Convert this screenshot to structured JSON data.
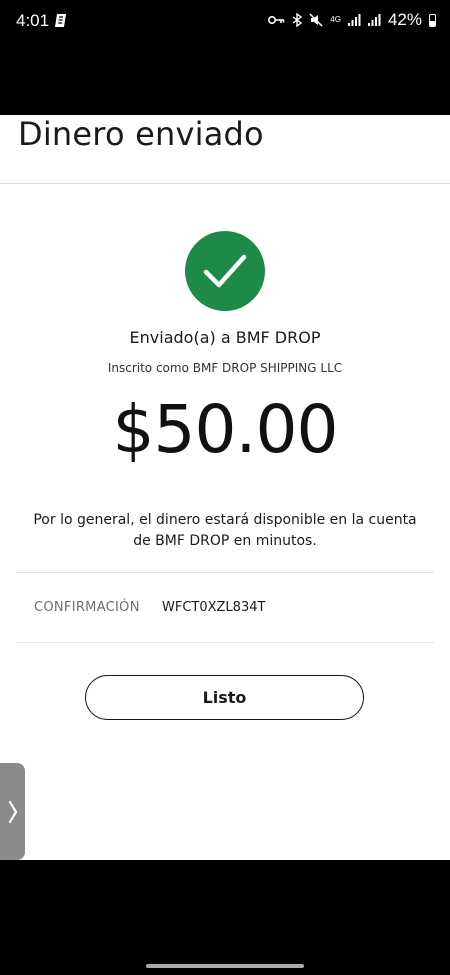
{
  "status_bar": {
    "time": "4:01",
    "network": "4G",
    "battery": "42%"
  },
  "page": {
    "title": "Dinero enviado"
  },
  "confirmation": {
    "sent_to": "Enviado(a) a BMF DROP",
    "registered_as": "Inscrito como BMF DROP SHIPPING LLC",
    "amount": "$50.00",
    "notice": "Por lo general, el dinero estará disponible en la cuenta de BMF DROP en minutos.",
    "conf_label": "CONFIRMACIÓN",
    "conf_value": "WFCT0XZL834T",
    "done_label": "Listo"
  },
  "colors": {
    "success": "#1e8a47",
    "background": "#ffffff",
    "system_bars": "#000000"
  },
  "icons": [
    "checkmark-icon",
    "vpn-key-icon",
    "bluetooth-icon",
    "mute-icon",
    "signal-icon",
    "battery-icon",
    "chevron-right-icon"
  ]
}
